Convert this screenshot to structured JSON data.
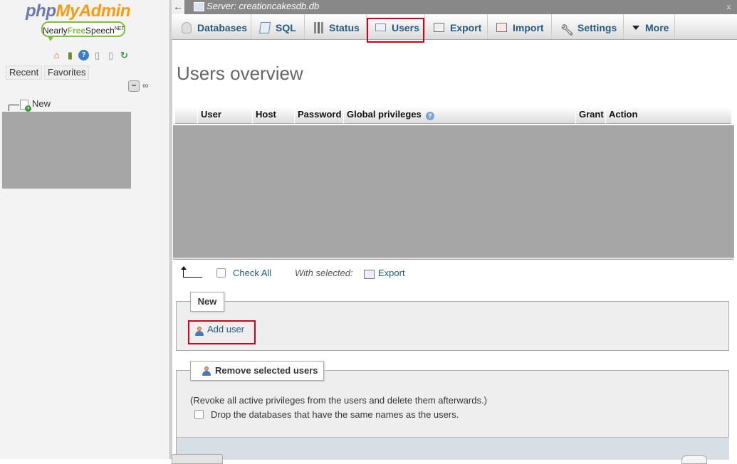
{
  "nav": {
    "logo_php": "php",
    "logo_myadmin": "MyAdmin",
    "host_badge_a": "Nearly",
    "host_badge_b": "Free",
    "host_badge_c": "Speech",
    "host_badge_sup": "NET",
    "recent": "Recent",
    "favorites": "Favorites",
    "collapse_symbol": "−",
    "link_symbol": "∞",
    "tree_new": "New"
  },
  "server": {
    "back_symbol": "←",
    "title": "Server: creationcakesdb.db",
    "collapse_symbol": "⌅"
  },
  "tabs": [
    {
      "label": "Databases",
      "icon": "database-icon"
    },
    {
      "label": "SQL",
      "icon": "sql-icon"
    },
    {
      "label": "Status",
      "icon": "status-icon"
    },
    {
      "label": "Users",
      "icon": "users-icon",
      "active": true
    },
    {
      "label": "Export",
      "icon": "export-icon"
    },
    {
      "label": "Import",
      "icon": "import-icon"
    },
    {
      "label": "Settings",
      "icon": "settings-icon"
    },
    {
      "label": "More",
      "icon": "chevron-down-icon"
    }
  ],
  "main": {
    "title": "Users overview",
    "columns": [
      "User",
      "Host",
      "Password",
      "Global privileges",
      "Grant",
      "Action"
    ],
    "help_symbol": "?",
    "check_all": "Check All",
    "with_selected": "With selected:",
    "export": "Export",
    "new_legend": "New",
    "add_user": "Add user",
    "remove_legend": "Remove selected users",
    "remove_desc": "(Revoke all active privileges from the users and delete them afterwards.)",
    "drop_label": "Drop the databases that have the same names as the users."
  },
  "colors": {
    "link": "#235a81",
    "highlight": "#d0021b",
    "server_bar": "#888888",
    "redacted": "#a6a6a6"
  }
}
